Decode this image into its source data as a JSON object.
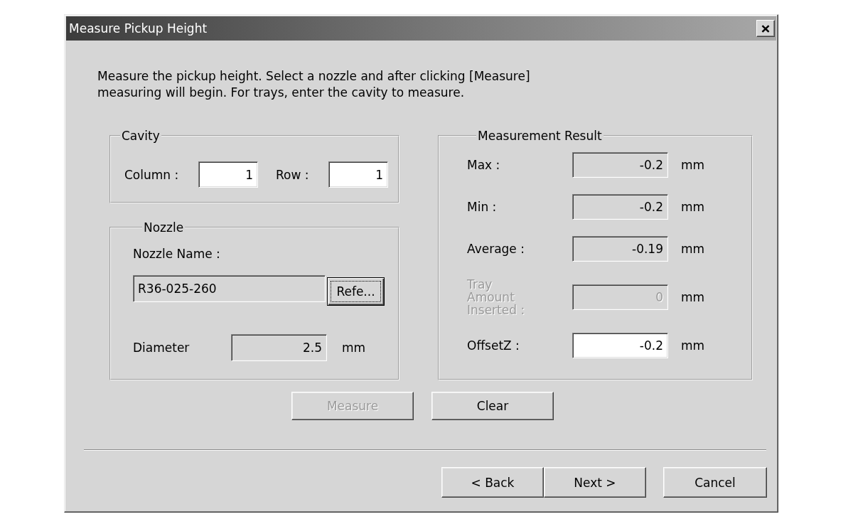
{
  "window": {
    "title": "Measure Pickup Height"
  },
  "instructions": "Measure the pickup height. Select a nozzle and after clicking [Measure]\nmeasuring will begin. For trays, enter the cavity to measure.",
  "cavity": {
    "title": "Cavity",
    "fields": [
      {
        "label": "Column :",
        "value": "1",
        "read_only": false
      },
      {
        "label": "Row :",
        "value": "1",
        "read_only": false
      }
    ]
  },
  "nozzle": {
    "title": "Nozzle",
    "name_field": {
      "label": "Nozzle Name :",
      "value": "R36-025-260",
      "read_only": true
    },
    "reference_button": {
      "label": "Refe...",
      "focused": true
    },
    "diameter": {
      "label": "Diameter",
      "value": "2.5",
      "unit": "mm",
      "read_only": true
    }
  },
  "measurement_result": {
    "title": "Measurement Result",
    "rows": [
      {
        "label": "Max :",
        "value": "-0.2",
        "unit": "mm",
        "read_only": true,
        "disabled": false
      },
      {
        "label": "Min :",
        "value": "-0.2",
        "unit": "mm",
        "read_only": true,
        "disabled": false
      },
      {
        "label": "Average :",
        "value": "-0.19",
        "unit": "mm",
        "read_only": true,
        "disabled": false
      },
      {
        "label": "Tray Amount Inserted :",
        "value": "0",
        "unit": "mm",
        "read_only": true,
        "disabled": true
      },
      {
        "label": "OffsetZ :",
        "value": "-0.2",
        "unit": "mm",
        "read_only": false,
        "disabled": false
      }
    ]
  },
  "actions": [
    {
      "label": "Measure",
      "disabled": true
    },
    {
      "label": "Clear",
      "disabled": false
    }
  ],
  "navigation": [
    {
      "label": "< Back"
    },
    {
      "label": "Next >"
    }
  ],
  "cancel_button": {
    "label": "Cancel"
  }
}
